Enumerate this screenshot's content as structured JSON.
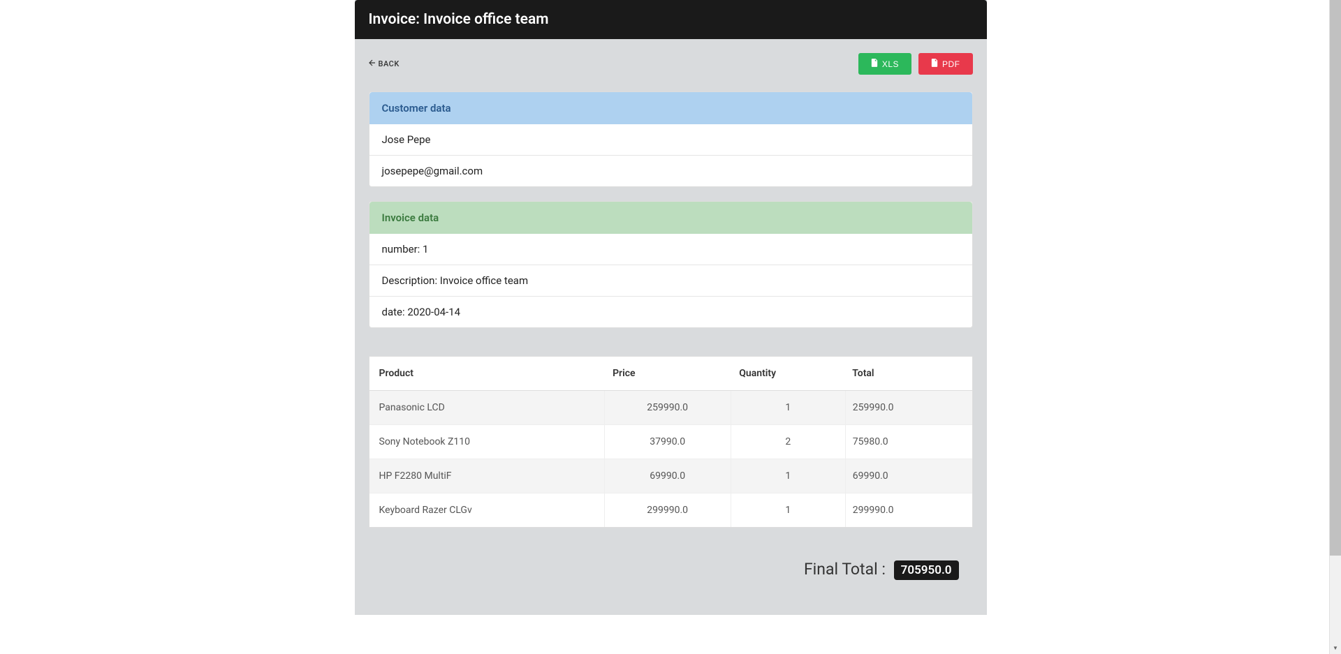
{
  "header": {
    "title": "Invoice: Invoice office team"
  },
  "toolbar": {
    "back_label": "BACK",
    "xls_label": "XLS",
    "pdf_label": "PDF"
  },
  "customer_panel": {
    "title": "Customer data",
    "name": "Jose Pepe",
    "email": "josepepe@gmail.com"
  },
  "invoice_panel": {
    "title": "Invoice data",
    "number": "number: 1",
    "description": "Description: Invoice office team",
    "date": "date: 2020-04-14"
  },
  "table": {
    "headers": {
      "product": "Product",
      "price": "Price",
      "quantity": "Quantity",
      "total": "Total"
    },
    "rows": [
      {
        "product": "Panasonic LCD",
        "price": "259990.0",
        "quantity": "1",
        "total": "259990.0"
      },
      {
        "product": "Sony Notebook Z110",
        "price": "37990.0",
        "quantity": "2",
        "total": "75980.0"
      },
      {
        "product": "HP F2280 MultiF",
        "price": "69990.0",
        "quantity": "1",
        "total": "69990.0"
      },
      {
        "product": "Keyboard Razer CLGv",
        "price": "299990.0",
        "quantity": "1",
        "total": "299990.0"
      }
    ]
  },
  "final_total": {
    "label": "Final Total :",
    "value": "705950.0"
  }
}
